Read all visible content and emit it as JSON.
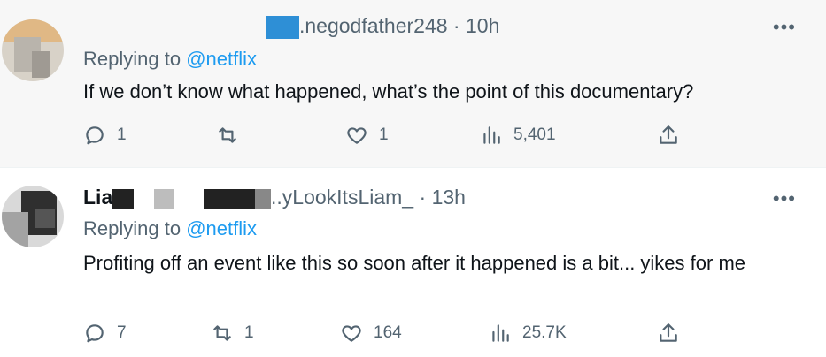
{
  "tweets": [
    {
      "handle_visible": ".negodfather248",
      "time": "10h",
      "replying_prefix": "Replying to",
      "replying_handle": "@netflix",
      "text": "If we don’t know what happened, what’s the point of this documentary?",
      "replies": "1",
      "retweets": "",
      "likes": "1",
      "views": "5,401",
      "more_label": "•••"
    },
    {
      "name_visible": "Lia",
      "handle_visible": "..yLookItsLiam_",
      "time": "13h",
      "replying_prefix": "Replying to",
      "replying_handle": "@netflix",
      "text": "Profiting off an event like this so soon after it happened is a bit... yikes for me",
      "replies": "7",
      "retweets": "1",
      "likes": "164",
      "views": "25.7K",
      "more_label": "•••"
    }
  ],
  "colors": {
    "text": "#0f1419",
    "muted": "#536471",
    "link": "#1d9bf0",
    "first_bg": "#f7f7f7"
  },
  "icons": [
    "reply-icon",
    "retweet-icon",
    "like-icon",
    "views-icon",
    "share-icon",
    "more-icon"
  ]
}
